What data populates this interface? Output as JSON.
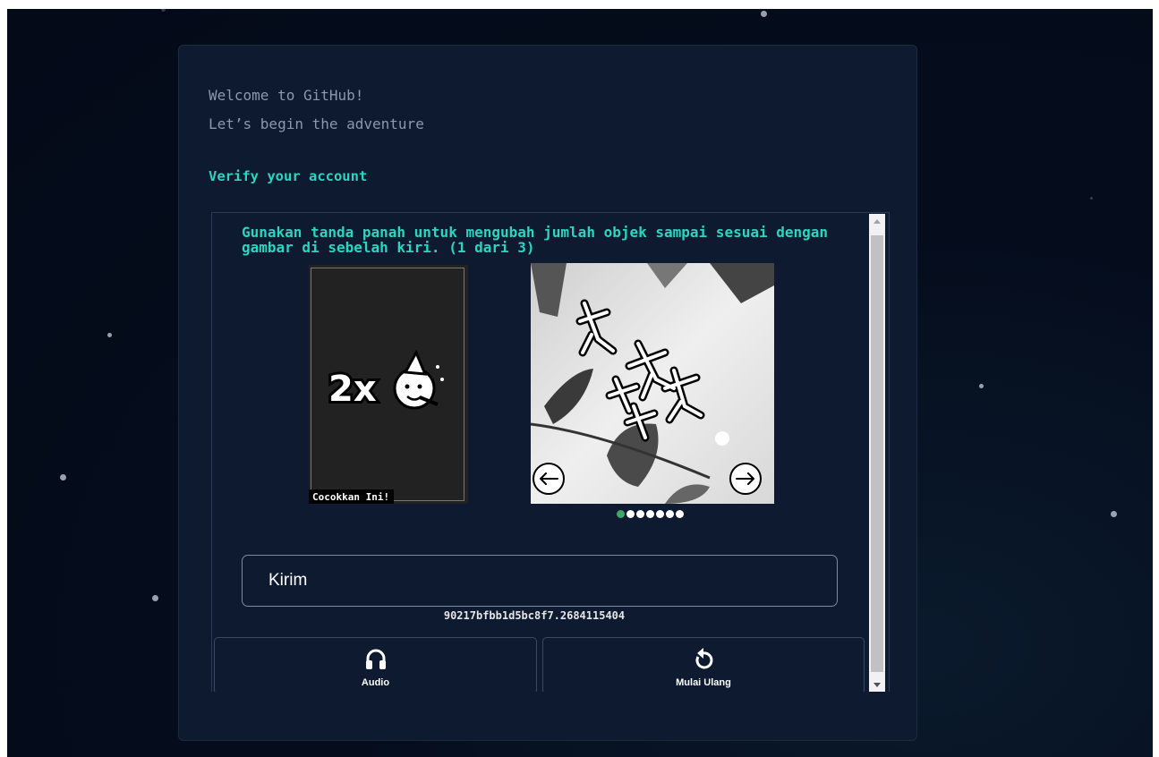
{
  "intro": {
    "line1": "Welcome to GitHub!",
    "line2": "Let’s begin the adventure"
  },
  "verify": {
    "title": "Verify your account"
  },
  "captcha": {
    "instruction": "Gunakan tanda panah untuk mengubah jumlah objek sampai sesuai dengan gambar di sebelah kiri. (1 dari 3)",
    "reference_text": "2x",
    "match_label": "Cocokkan Ini!",
    "dots_total": 7,
    "dots_active_index": 0,
    "submit_label": "Kirim",
    "session_id": "90217bfbb1d5bc8f7.2684115404",
    "audio_label": "Audio",
    "restart_label": "Mulai Ulang"
  },
  "icons": {
    "left_arrow": "left-arrow-icon",
    "right_arrow": "right-arrow-icon",
    "audio": "headphones-icon",
    "restart": "restart-icon"
  },
  "colors": {
    "accent": "#2dd4bf",
    "card_bg": "#0d1a2f",
    "page_bg": "#050d1d",
    "active_dot": "#3fa66a"
  }
}
